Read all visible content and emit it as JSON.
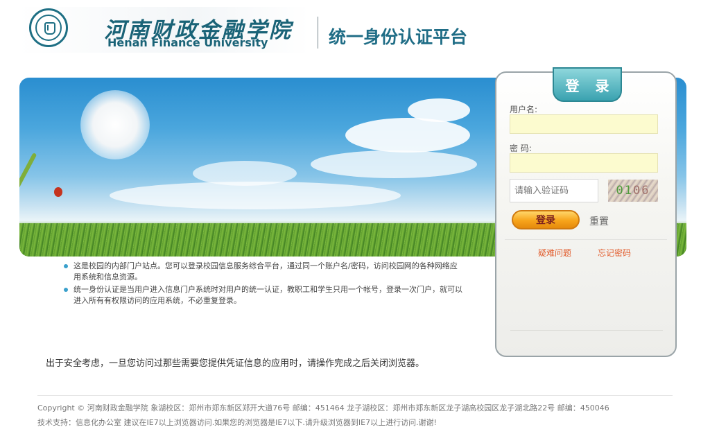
{
  "header": {
    "university_name_cn": "河南财政金融学院",
    "university_name_en": "Henan Finance University",
    "platform_title": "统一身份认证平台"
  },
  "login": {
    "tab_label": "登 录",
    "username_label": "用户名:",
    "username_value": "",
    "password_label": "密 码:",
    "password_value": "",
    "captcha_placeholder": "请输入验证码",
    "captcha_prefix": "01",
    "captcha_suffix": "06",
    "login_button": "登录",
    "reset_button": "重置",
    "help_link": "疑难问题",
    "forgot_link": "忘记密码"
  },
  "info": {
    "items": [
      "这是校园的内部门户站点。您可以登录校园信息服务综合平台，通过同一个账户名/密码，访问校园网的各种网络应用系统和信息资源。",
      "统一身份认证是当用户进入信息门户系统时对用户的统一认证，教职工和学生只用一个帐号，登录一次门户，就可以进入所有有权限访问的应用系统，不必重复登录。"
    ],
    "security_note": "出于安全考虑，一旦您访问过那些需要您提供凭证信息的应用时，请操作完成之后关闭浏览器。"
  },
  "footer": {
    "line1": "Copyright © 河南财政金融学院 象湖校区：郑州市郑东新区郑开大道76号 邮编：451464 龙子湖校区：郑州市郑东新区龙子湖高校园区龙子湖北路22号 邮编：450046",
    "line2": "技术支持：信息化办公室 建议在IE7以上浏览器访问.如果您的浏览器是IE7以下.请升级浏览器到IE7以上进行访问.谢谢!"
  },
  "colors": {
    "brand": "#1a6377",
    "accent": "#3aa2b0",
    "login_button": "#f7a41b",
    "link": "#e15a2a"
  },
  "icons": [
    "university-seal-icon",
    "bullet-icon"
  ]
}
